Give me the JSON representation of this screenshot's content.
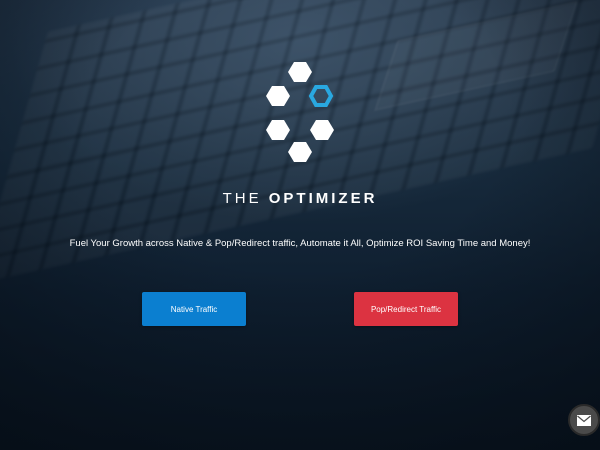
{
  "brand": {
    "name_light": "THE",
    "name_bold": "OPTIMIZER"
  },
  "tagline": "Fuel Your Growth across Native & Pop/Redirect traffic, Automate it All, Optimize ROI Saving Time and Money!",
  "buttons": {
    "native_label": "Native Traffic",
    "pop_label": "Pop/Redirect Traffic"
  },
  "colors": {
    "native_button": "#0b7fd0",
    "pop_button": "#dc3341",
    "logo_accent": "#29a8e0",
    "logo_white": "#ffffff"
  },
  "icons": {
    "logo": "hexagon-cluster-logo",
    "chat": "chat-envelope-icon"
  }
}
